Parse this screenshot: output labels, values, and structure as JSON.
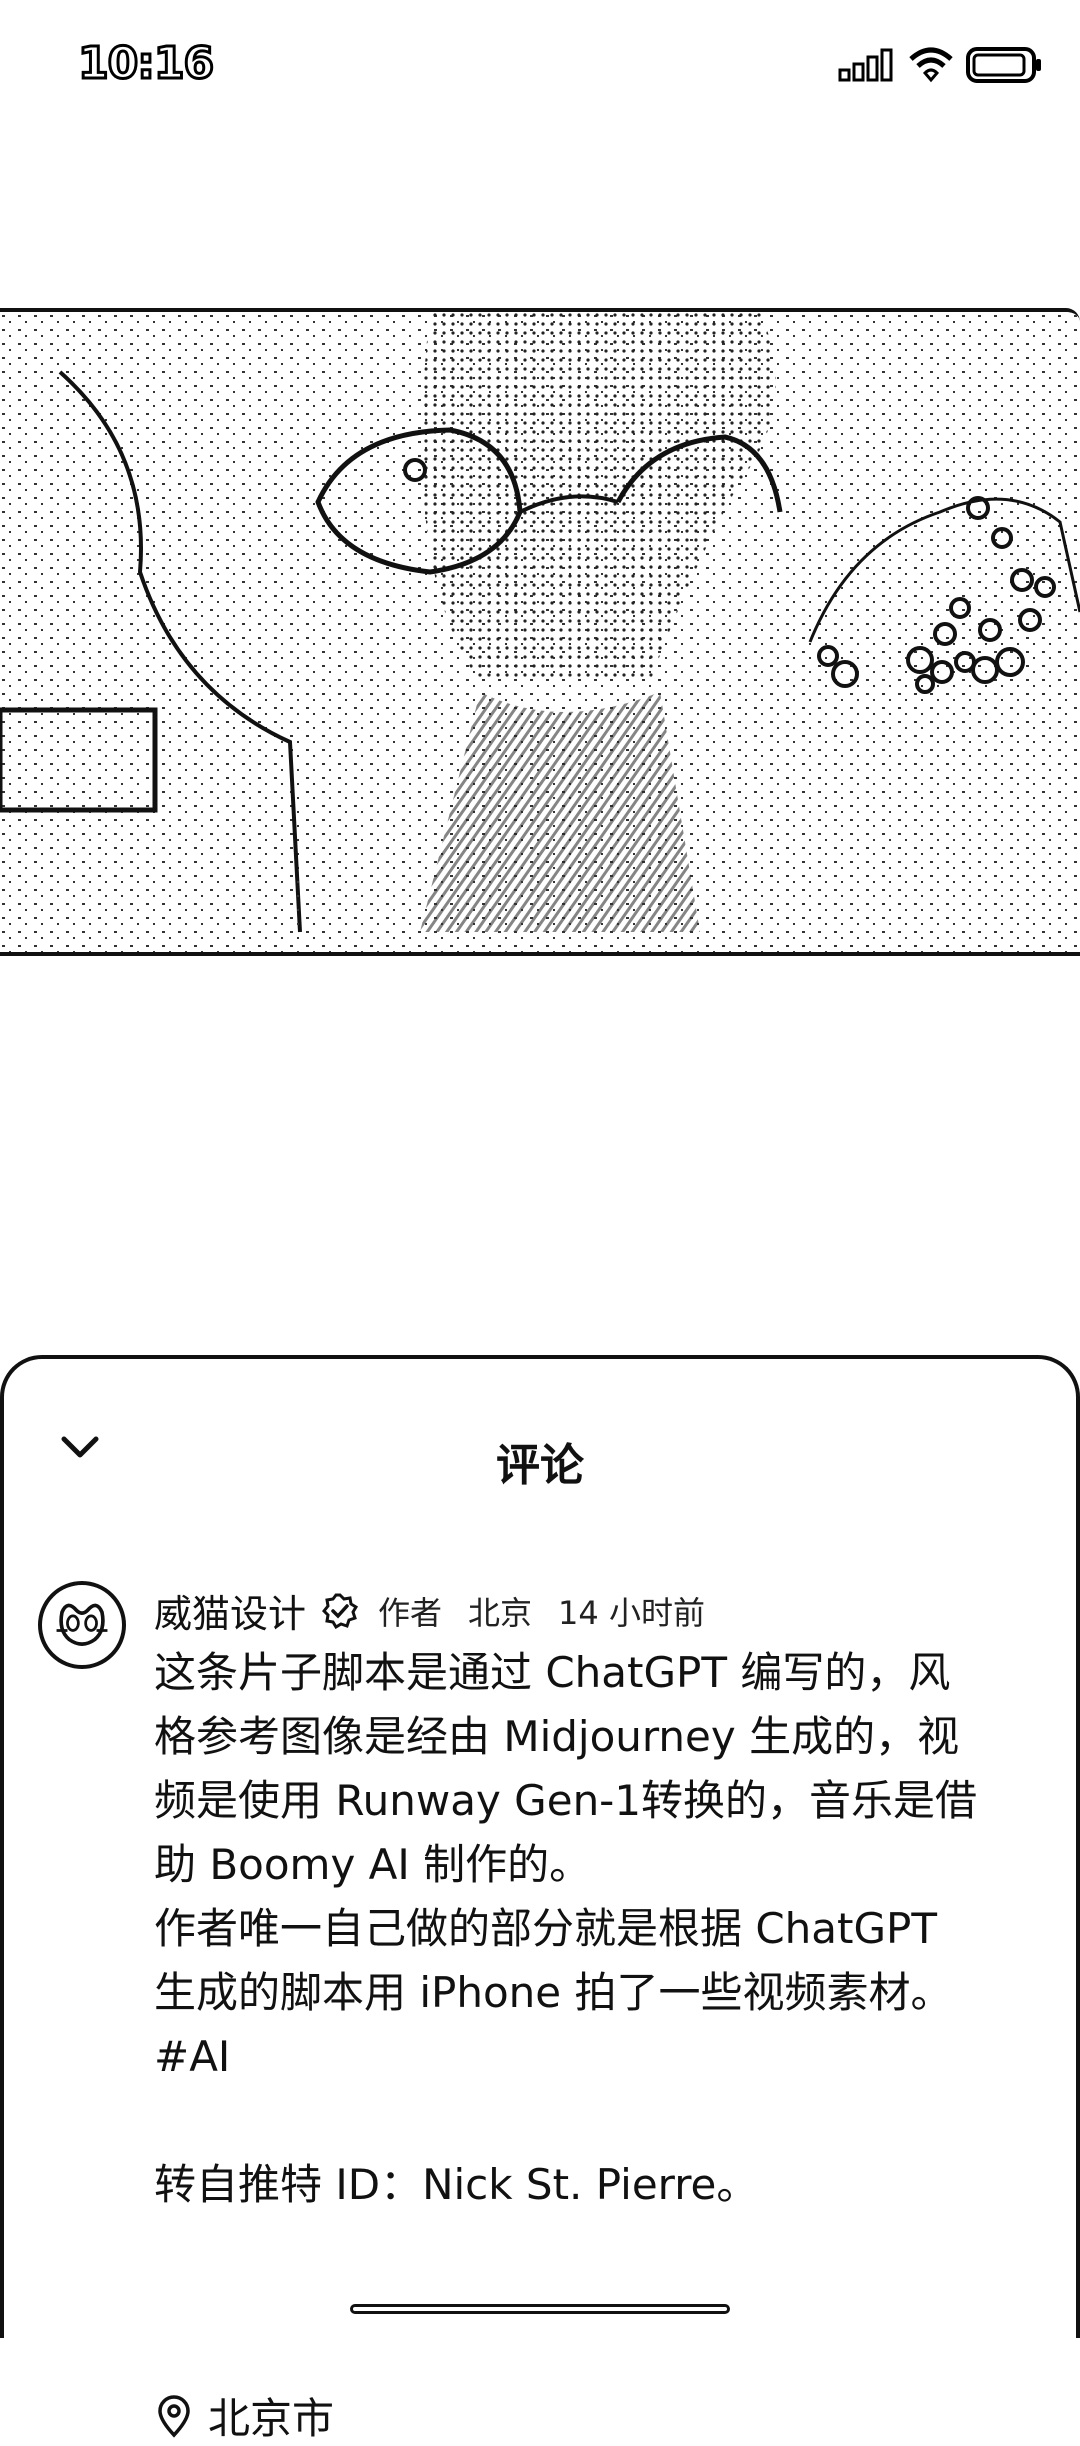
{
  "status_bar": {
    "time": "10:16",
    "icons": [
      "cellular-signal-icon",
      "wifi-icon",
      "battery-icon"
    ]
  },
  "video": {
    "description_icon": "video-frame"
  },
  "comments_sheet": {
    "title": "评论",
    "collapse_icon": "chevron-down-icon",
    "comment": {
      "author": "威猫设计",
      "badge": "作者",
      "location_tag": "北京",
      "time_ago": "14 小时前",
      "body_lines": [
        "这条片子脚本是通过 ChatGPT 编写的，风",
        "格参考图像是经由 Midjourney 生成的，视",
        "频是使用 Runway Gen-1转换的，音乐是借",
        "助 Boomy AI 制作的。",
        "作者唯一自己做的部分就是根据 ChatGPT",
        "生成的脚本用 iPhone 拍了一些视频素材。",
        "#AI",
        "",
        "转自推特 ID：Nick St. Pierre。"
      ],
      "location": "北京市"
    }
  },
  "colors": {
    "ink": "#111111",
    "background": "#ffffff"
  }
}
